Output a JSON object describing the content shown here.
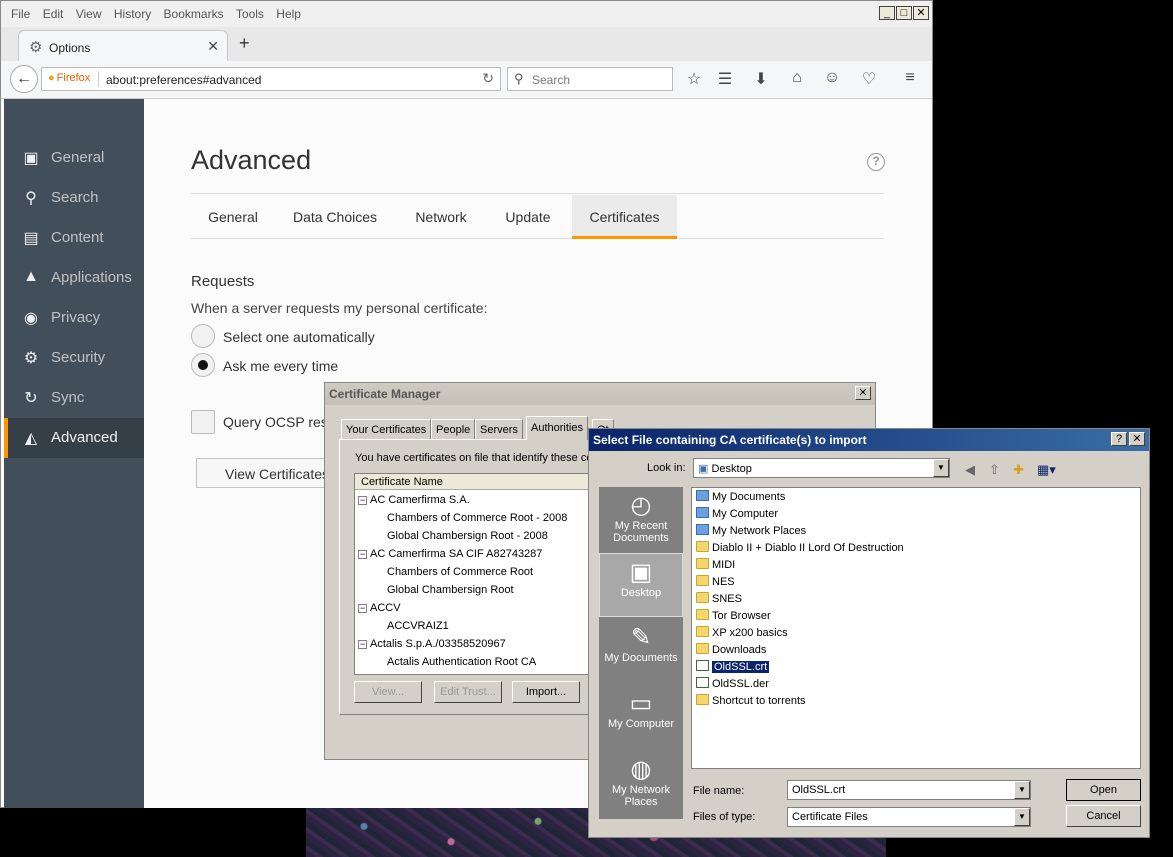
{
  "firefox": {
    "menu": [
      "File",
      "Edit",
      "View",
      "History",
      "Bookmarks",
      "Tools",
      "Help"
    ],
    "window_controls": {
      "minimize": "_",
      "maximize": "□",
      "close": "✕"
    },
    "tab": {
      "title": "Options",
      "close": "✕"
    },
    "newtab": "+",
    "url_identity": "Firefox",
    "url": "about:preferences#advanced",
    "search_placeholder": "Search"
  },
  "sidebar": {
    "items": [
      {
        "label": "General",
        "icon": "general-icon"
      },
      {
        "label": "Search",
        "icon": "search-icon"
      },
      {
        "label": "Content",
        "icon": "content-icon"
      },
      {
        "label": "Applications",
        "icon": "applications-icon"
      },
      {
        "label": "Privacy",
        "icon": "privacy-icon"
      },
      {
        "label": "Security",
        "icon": "security-icon"
      },
      {
        "label": "Sync",
        "icon": "sync-icon"
      },
      {
        "label": "Advanced",
        "icon": "advanced-icon",
        "active": true
      }
    ]
  },
  "main": {
    "title": "Advanced",
    "help": "?",
    "tabs": [
      "General",
      "Data Choices",
      "Network",
      "Update",
      "Certificates"
    ],
    "active_tab": "Certificates",
    "requests_heading": "Requests",
    "requests_desc": "When a server requests my personal certificate:",
    "radio_auto": "Select one automatically",
    "radio_ask": "Ask me every time",
    "ocsp_label": "Query OCSP resp",
    "view_certs_button": "View Certificates"
  },
  "cert_manager": {
    "title": "Certificate Manager",
    "close": "✕",
    "tabs": [
      "Your Certificates",
      "People",
      "Servers",
      "Authorities",
      "Ot"
    ],
    "active_tab": "Authorities",
    "info": "You have certificates on file that identify these ce",
    "column": "Certificate Name",
    "tree": [
      {
        "text": "AC Camerfirma S.A.",
        "group": true
      },
      {
        "text": "Chambers of Commerce Root - 2008",
        "group": false
      },
      {
        "text": "Global Chambersign Root - 2008",
        "group": false
      },
      {
        "text": "AC Camerfirma SA CIF A82743287",
        "group": true
      },
      {
        "text": "Chambers of Commerce Root",
        "group": false
      },
      {
        "text": "Global Chambersign Root",
        "group": false
      },
      {
        "text": "ACCV",
        "group": true
      },
      {
        "text": "ACCVRAIZ1",
        "group": false
      },
      {
        "text": "Actalis S.p.A./03358520967",
        "group": true
      },
      {
        "text": "Actalis Authentication Root CA",
        "group": false
      }
    ],
    "buttons": {
      "view": "View...",
      "edit_trust": "Edit Trust...",
      "import": "Import..."
    }
  },
  "file_dialog": {
    "title": "Select File containing CA certificate(s) to import",
    "help": "?",
    "close": "✕",
    "look_in_label": "Look in:",
    "look_in_value": "Desktop",
    "places": [
      {
        "label": "My Recent Documents",
        "icon": "recent-documents-icon"
      },
      {
        "label": "Desktop",
        "icon": "desktop-icon",
        "active": true
      },
      {
        "label": "My Documents",
        "icon": "my-documents-icon"
      },
      {
        "label": "My Computer",
        "icon": "my-computer-icon"
      },
      {
        "label": "My Network Places",
        "icon": "network-places-icon"
      }
    ],
    "files": [
      {
        "name": "My Documents",
        "type": "sys"
      },
      {
        "name": "My Computer",
        "type": "sys"
      },
      {
        "name": "My Network Places",
        "type": "sys"
      },
      {
        "name": "Diablo II + Diablo II Lord Of Destruction",
        "type": "folder"
      },
      {
        "name": "MIDI",
        "type": "folder"
      },
      {
        "name": "NES",
        "type": "folder"
      },
      {
        "name": "SNES",
        "type": "folder"
      },
      {
        "name": "Tor Browser",
        "type": "folder"
      },
      {
        "name": "XP x200 basics",
        "type": "folder"
      },
      {
        "name": "Downloads",
        "type": "folder"
      },
      {
        "name": "OldSSL.crt",
        "type": "doc",
        "selected": true
      },
      {
        "name": "OldSSL.der",
        "type": "doc"
      },
      {
        "name": "Shortcut to torrents",
        "type": "folder"
      }
    ],
    "filename_label": "File name:",
    "filename_value": "OldSSL.crt",
    "filetype_label": "Files of type:",
    "filetype_value": "Certificate Files",
    "open_button": "Open",
    "cancel_button": "Cancel"
  }
}
